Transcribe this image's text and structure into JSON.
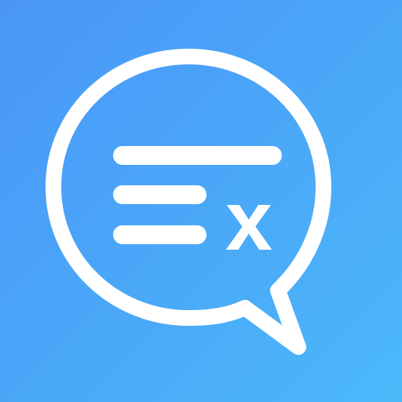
{
  "icon": {
    "name": "chat-bubble-ex-icon",
    "glyph": "x",
    "colors": {
      "background_start": "#4a96f7",
      "background_end": "#4bb8f9",
      "foreground": "#ffffff"
    }
  }
}
